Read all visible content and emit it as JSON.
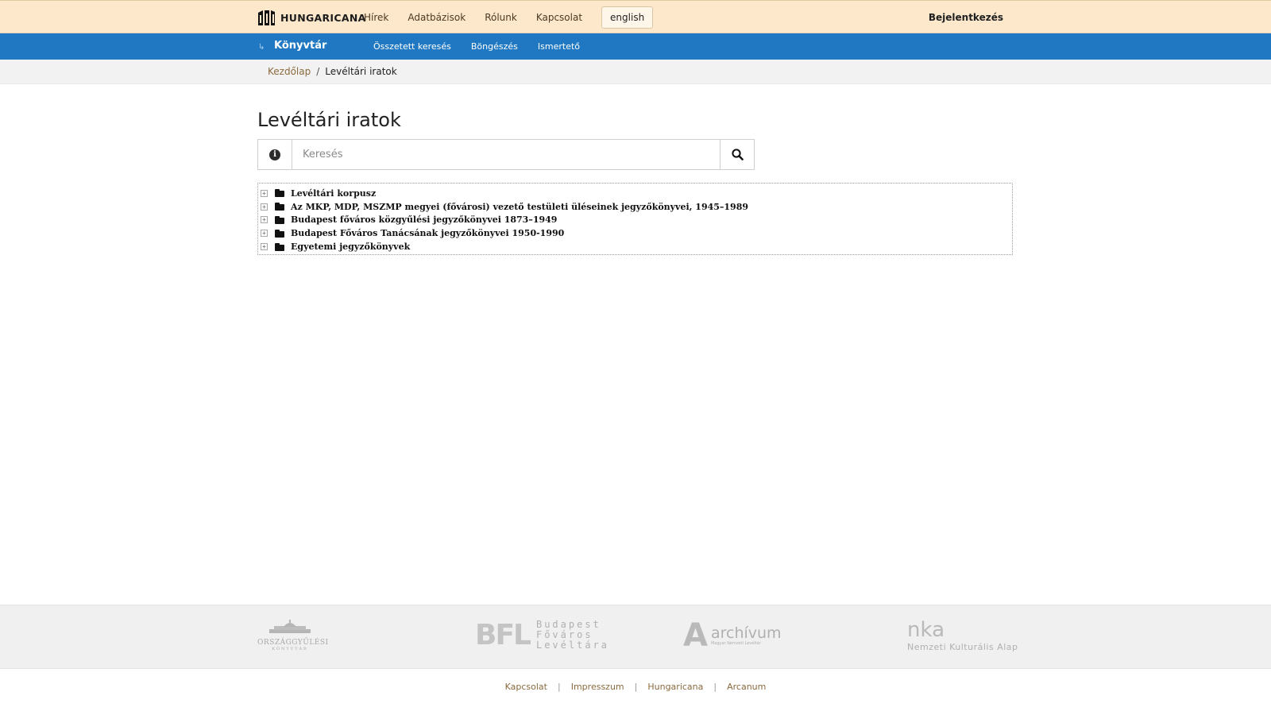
{
  "header": {
    "logo_text": "HUNGARICANA",
    "nav": [
      "Hírek",
      "Adatbázisok",
      "Rólunk",
      "Kapcsolat"
    ],
    "language_button": "english",
    "login": "Bejelentkezés"
  },
  "section": {
    "title": "Könyvtár",
    "nav": [
      "Összetett keresés",
      "Böngészés",
      "Ismertető"
    ]
  },
  "breadcrumb": {
    "home": "Kezdőlap",
    "separator": "/",
    "current": "Levéltári iratok"
  },
  "page": {
    "title": "Levéltári iratok"
  },
  "search": {
    "placeholder": "Keresés",
    "info_glyph": "i"
  },
  "tree": {
    "expander_glyph": "+",
    "items": [
      "Levéltári korpusz",
      "Az MKP, MDP, MSZMP megyei (fővárosi) vezető testületi üléseinek jegyzőkönyvei, 1945–1989",
      "Budapest főváros közgyűlési jegyzőkönyvei 1873–1949",
      "Budapest Főváros Tanácsának jegyzőkönyvei 1950-1990",
      "Egyetemi jegyzőkönyvek"
    ]
  },
  "partners": {
    "ogyk": {
      "line1": "ORSZÁGGYŰLÉSI",
      "line2": "KÖNYVTÁR"
    },
    "bfl": {
      "mark": "BFL",
      "lines": [
        "Budapest",
        "Főváros",
        "Levéltára"
      ]
    },
    "archivum": {
      "mark": "A",
      "name": "archívum",
      "sub": "Magyar Nemzeti Levéltár"
    },
    "nka": {
      "mark": "nka",
      "name": "Nemzeti Kulturális Alap"
    }
  },
  "footer": {
    "links": [
      "Kapcsolat",
      "Impresszum",
      "Hungaricana",
      "Arcanum"
    ],
    "separator": "|"
  },
  "colors": {
    "topbar_bg": "#fde8cc",
    "section_bar_bg": "#1f78c1",
    "link_brown": "#8b6a3e"
  }
}
